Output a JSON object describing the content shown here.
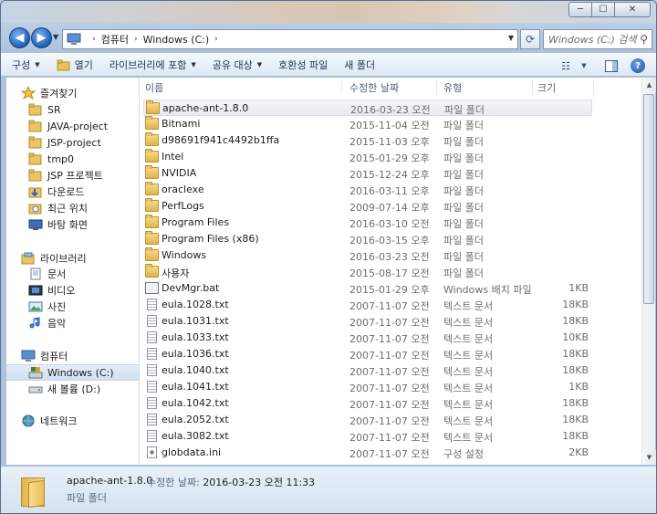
{
  "window": {
    "controls": [
      "─",
      "☐",
      "✕"
    ]
  },
  "address": {
    "crumbs": [
      "컴퓨터",
      "Windows (C:)"
    ],
    "search_placeholder": "Windows (C:) 검색"
  },
  "toolbar": {
    "items": [
      "구성",
      "열기",
      "라이브러리에 포함",
      "공유 대상",
      "호환성 파일",
      "새 폴더"
    ]
  },
  "nav": {
    "favorites_header": "즐겨찾기",
    "favorites": [
      "SR",
      "JAVA-project",
      "JSP-project",
      "tmp0",
      "JSP 프로젝트",
      "다운로드",
      "최근 위치",
      "바탕 화면"
    ],
    "libraries_header": "라이브러리",
    "libraries": [
      "문서",
      "비디오",
      "사진",
      "음악"
    ],
    "computer_header": "컴퓨터",
    "computer": [
      "Windows (C:)",
      "새 볼륨 (D:)"
    ],
    "network_header": "네트워크"
  },
  "columns": [
    "이름",
    "수정한 날짜",
    "유형",
    "크기"
  ],
  "files": [
    {
      "name": "apache-ant-1.8.0",
      "date": "2016-03-23 오전 11:33",
      "type": "파일 폴더",
      "size": "",
      "kind": "folder"
    },
    {
      "name": "Bitnami",
      "date": "2015-11-04 오전",
      "type": "파일 폴더",
      "size": "",
      "kind": "folder"
    },
    {
      "name": "d98691f941c4492b1ffa",
      "date": "2015-11-03 오후",
      "type": "파일 폴더",
      "size": "",
      "kind": "folder"
    },
    {
      "name": "Intel",
      "date": "2015-01-29 오후",
      "type": "파일 폴더",
      "size": "",
      "kind": "folder"
    },
    {
      "name": "NVIDIA",
      "date": "2015-12-24 오후",
      "type": "파일 폴더",
      "size": "",
      "kind": "folder"
    },
    {
      "name": "oraclexe",
      "date": "2016-03-11 오후",
      "type": "파일 폴더",
      "size": "",
      "kind": "folder"
    },
    {
      "name": "PerfLogs",
      "date": "2009-07-14 오후",
      "type": "파일 폴더",
      "size": "",
      "kind": "folder"
    },
    {
      "name": "Program Files",
      "date": "2016-03-10 오전",
      "type": "파일 폴더",
      "size": "",
      "kind": "folder"
    },
    {
      "name": "Program Files (x86)",
      "date": "2016-03-15 오후",
      "type": "파일 폴더",
      "size": "",
      "kind": "folder"
    },
    {
      "name": "Windows",
      "date": "2016-03-23 오전",
      "type": "파일 폴더",
      "size": "",
      "kind": "folder"
    },
    {
      "name": "사용자",
      "date": "2015-08-17 오전",
      "type": "파일 폴더",
      "size": "",
      "kind": "folder"
    },
    {
      "name": "DevMgr.bat",
      "date": "2015-01-29 오후",
      "type": "Windows 배치 파일",
      "size": "1KB",
      "kind": "bat"
    },
    {
      "name": "eula.1028.txt",
      "date": "2007-11-07 오전",
      "type": "텍스트 문서",
      "size": "18KB",
      "kind": "txt"
    },
    {
      "name": "eula.1031.txt",
      "date": "2007-11-07 오전",
      "type": "텍스트 문서",
      "size": "18KB",
      "kind": "txt"
    },
    {
      "name": "eula.1033.txt",
      "date": "2007-11-07 오전",
      "type": "텍스트 문서",
      "size": "10KB",
      "kind": "txt"
    },
    {
      "name": "eula.1036.txt",
      "date": "2007-11-07 오전",
      "type": "텍스트 문서",
      "size": "18KB",
      "kind": "txt"
    },
    {
      "name": "eula.1040.txt",
      "date": "2007-11-07 오전",
      "type": "텍스트 문서",
      "size": "18KB",
      "kind": "txt"
    },
    {
      "name": "eula.1041.txt",
      "date": "2007-11-07 오전",
      "type": "텍스트 문서",
      "size": "1KB",
      "kind": "txt"
    },
    {
      "name": "eula.1042.txt",
      "date": "2007-11-07 오전",
      "type": "텍스트 문서",
      "size": "18KB",
      "kind": "txt"
    },
    {
      "name": "eula.2052.txt",
      "date": "2007-11-07 오전",
      "type": "텍스트 문서",
      "size": "18KB",
      "kind": "txt"
    },
    {
      "name": "eula.3082.txt",
      "date": "2007-11-07 오전",
      "type": "텍스트 문서",
      "size": "18KB",
      "kind": "txt"
    },
    {
      "name": "globdata.ini",
      "date": "2007-11-07 오전",
      "type": "구성 설정",
      "size": "2KB",
      "kind": "ini"
    }
  ],
  "details": {
    "name": "apache-ant-1.8.0",
    "modified_label": "수정한 날짜:",
    "modified_value": "2016-03-23 오전 11:33",
    "type": "파일 폴더"
  },
  "icons": {
    "back": "back-arrow-icon",
    "forward": "forward-arrow-icon",
    "refresh": "refresh-icon",
    "search": "search-icon",
    "views": "views-icon",
    "preview_pane": "preview-pane-icon",
    "help": "help-icon"
  }
}
